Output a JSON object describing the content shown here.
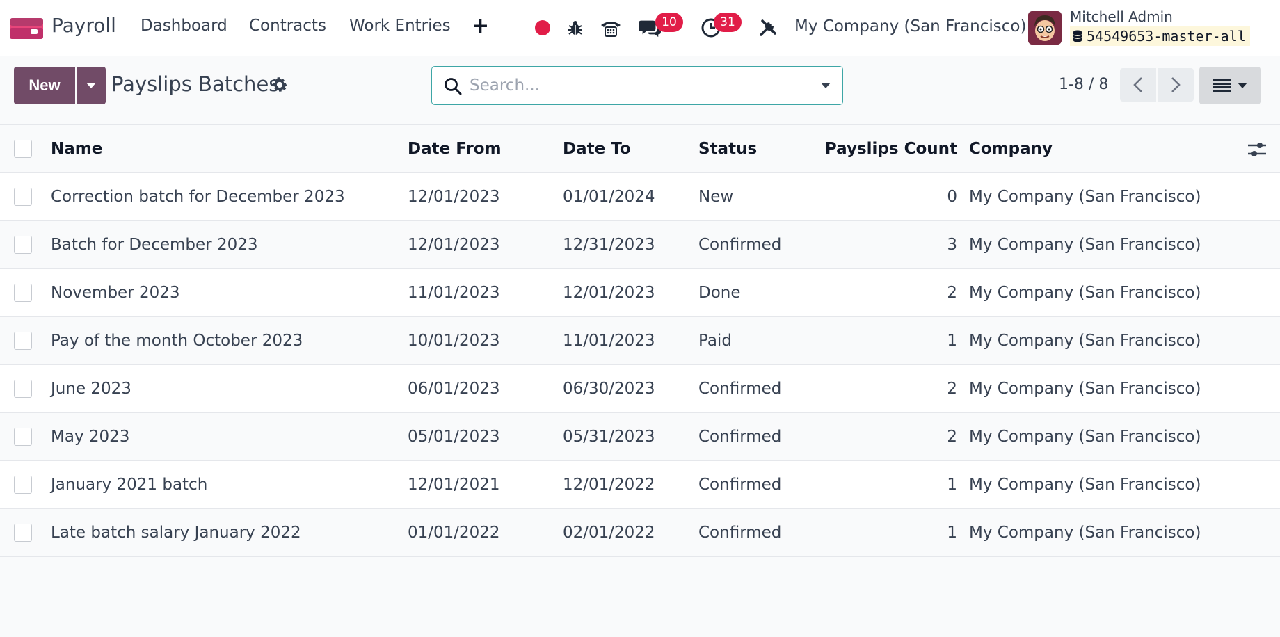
{
  "navbar": {
    "app_name": "Payroll",
    "menu": [
      "Dashboard",
      "Contracts",
      "Work Entries"
    ],
    "plus": "+",
    "messages_badge": "10",
    "activities_badge": "31",
    "company": "My Company (San Francisco)",
    "user_name": "Mitchell Admin",
    "database": "54549653-master-all",
    "accent": "#714b67",
    "badge_color": "#e11d48"
  },
  "control_panel": {
    "new_label": "New",
    "title": "Payslips Batches",
    "search_placeholder": "Search...",
    "pager": "1-8 / 8"
  },
  "table": {
    "columns": {
      "name": "Name",
      "date_from": "Date From",
      "date_to": "Date To",
      "status": "Status",
      "count": "Payslips Count",
      "company": "Company"
    },
    "rows": [
      {
        "name": "Correction batch for December 2023",
        "date_from": "12/01/2023",
        "date_to": "01/01/2024",
        "status": "New",
        "count": "0",
        "company": "My Company (San Francisco)"
      },
      {
        "name": "Batch for December 2023",
        "date_from": "12/01/2023",
        "date_to": "12/31/2023",
        "status": "Confirmed",
        "count": "3",
        "company": "My Company (San Francisco)"
      },
      {
        "name": "November 2023",
        "date_from": "11/01/2023",
        "date_to": "12/01/2023",
        "status": "Done",
        "count": "2",
        "company": "My Company (San Francisco)"
      },
      {
        "name": "Pay of the month October 2023",
        "date_from": "10/01/2023",
        "date_to": "11/01/2023",
        "status": "Paid",
        "count": "1",
        "company": "My Company (San Francisco)"
      },
      {
        "name": "June 2023",
        "date_from": "06/01/2023",
        "date_to": "06/30/2023",
        "status": "Confirmed",
        "count": "2",
        "company": "My Company (San Francisco)"
      },
      {
        "name": "May 2023",
        "date_from": "05/01/2023",
        "date_to": "05/31/2023",
        "status": "Confirmed",
        "count": "2",
        "company": "My Company (San Francisco)"
      },
      {
        "name": "January 2021 batch",
        "date_from": "12/01/2021",
        "date_to": "12/01/2022",
        "status": "Confirmed",
        "count": "1",
        "company": "My Company (San Francisco)"
      },
      {
        "name": "Late batch salary January 2022",
        "date_from": "01/01/2022",
        "date_to": "02/01/2022",
        "status": "Confirmed",
        "count": "1",
        "company": "My Company (San Francisco)"
      }
    ]
  }
}
